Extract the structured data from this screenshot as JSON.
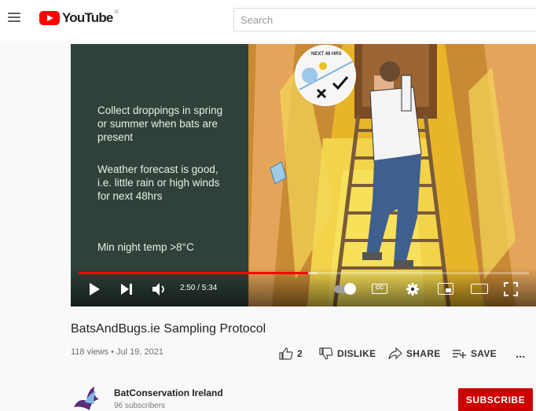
{
  "header": {
    "logo_text": "YouTube",
    "logo_region": "IE",
    "search_placeholder": "Search"
  },
  "video": {
    "slide_lines": [
      "Collect droppings in spring or summer when bats are present",
      "Weather forecast is good, i.e. little rain or high winds for next 48hrs",
      "Min night temp >8°C"
    ],
    "weather_badge": "NEXT 48 HRS",
    "current_time": "2:50",
    "duration": "5:34",
    "time_display": "2:50 / 5:34",
    "progress_played_fraction": 0.509,
    "progress_loaded_fraction": 0.53,
    "cc_label": "CC"
  },
  "info": {
    "title": "BatsAndBugs.ie Sampling Protocol",
    "meta": "118 views • Jul 19, 2021",
    "like_count": "2",
    "dislike_label": "DISLIKE",
    "share_label": "SHARE",
    "save_label": "SAVE",
    "more_label": "..."
  },
  "channel": {
    "name": "BatConservation Ireland",
    "subscribers": "96 subscribers",
    "subscribe_label": "SUBSCRIBE"
  },
  "colors": {
    "brand_red": "#ff0000",
    "subscribe_red": "#cc0000",
    "slide_bg": "#2f4139"
  }
}
